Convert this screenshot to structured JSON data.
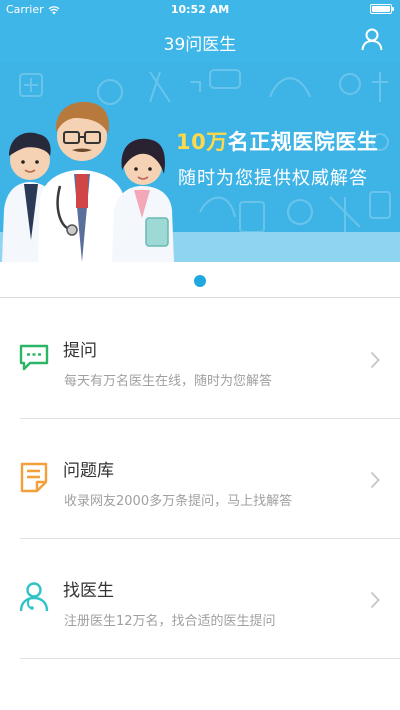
{
  "status_bar": {
    "carrier": "Carrier",
    "time": "10:52 AM"
  },
  "nav": {
    "title": "39问医生",
    "user_icon": "user-icon"
  },
  "banner": {
    "headline_number": "10万",
    "headline_rest": "名正规医院医生",
    "subline": "随时为您提供权威解答"
  },
  "pager": {
    "total": 1,
    "active": 1
  },
  "menu": {
    "items": [
      {
        "title": "提问",
        "desc": "每天有万名医生在线，随时为您解答",
        "icon": "chat-icon",
        "color": "#2bb567"
      },
      {
        "title": "问题库",
        "desc": "收录网友2000多万条提问，马上找解答",
        "icon": "document-icon",
        "color": "#f3a03a"
      },
      {
        "title": "找医生",
        "desc": "注册医生12万名，找合适的医生提问",
        "icon": "doctor-icon",
        "color": "#2fc3c6"
      }
    ]
  },
  "colors": {
    "primary": "#3fb6e8",
    "accent": "#1fa7e0"
  }
}
